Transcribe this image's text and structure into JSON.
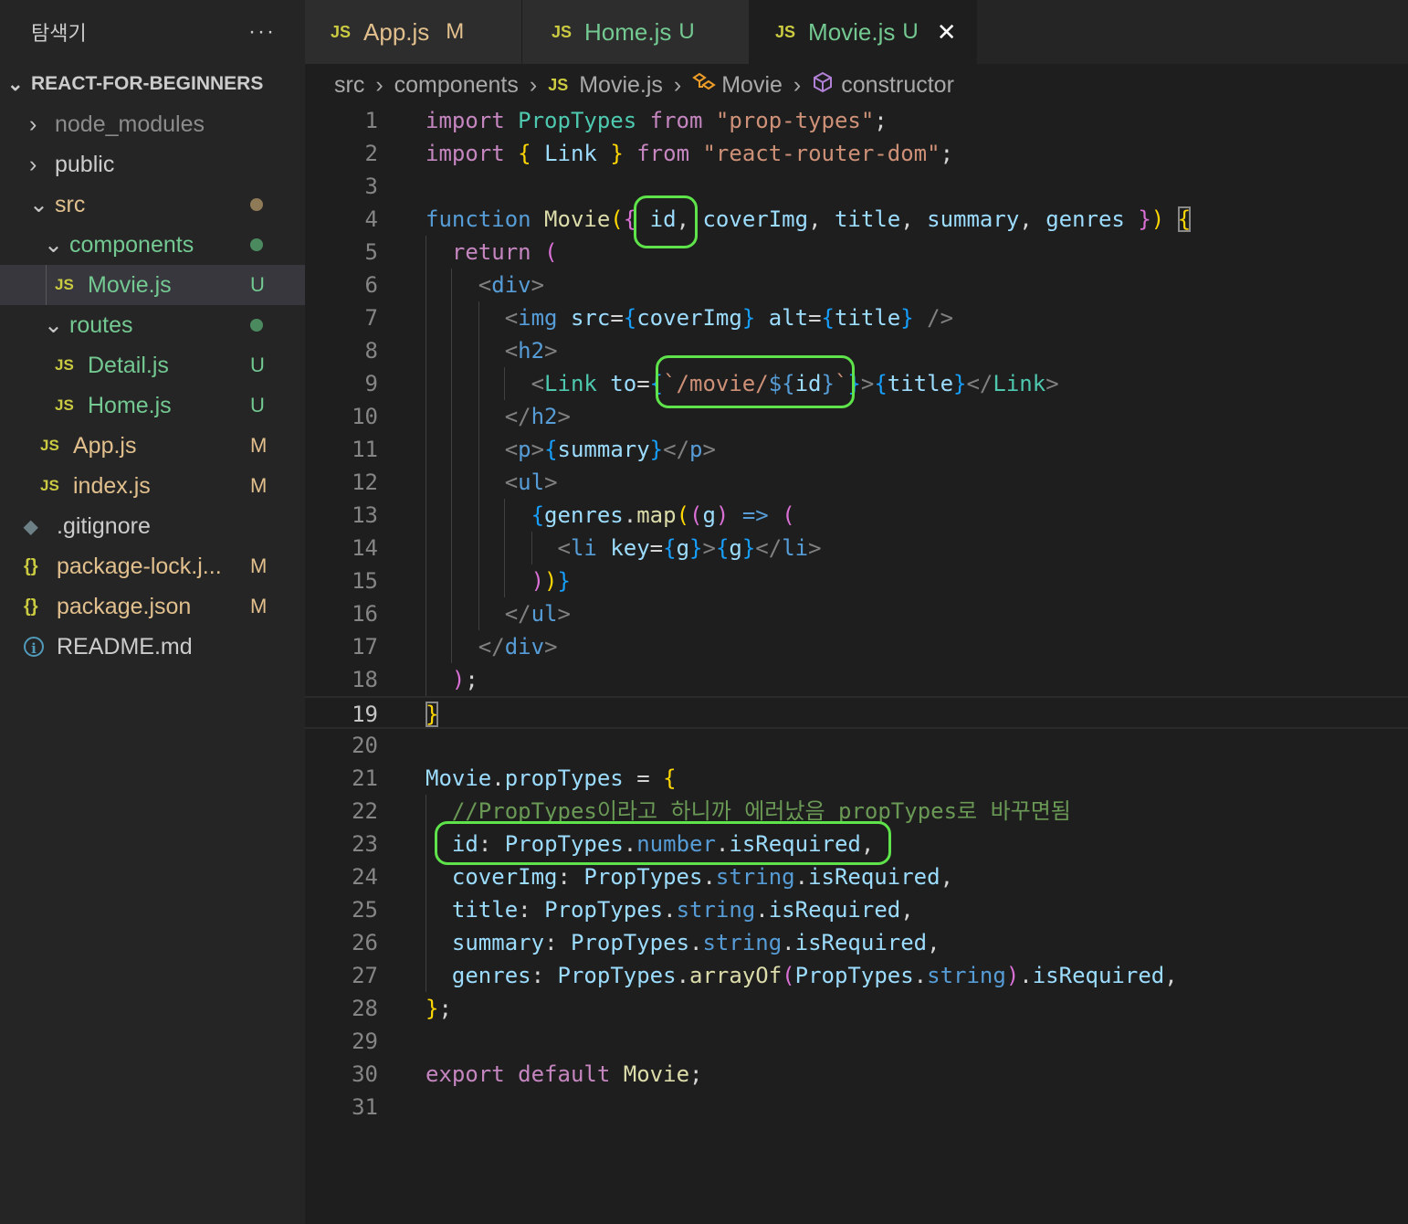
{
  "sidebar": {
    "title": "탐색기",
    "more": "···",
    "section": "REACT-FOR-BEGINNERS",
    "items": [
      {
        "label": "node_modules",
        "badge": ""
      },
      {
        "label": "public",
        "badge": ""
      },
      {
        "label": "src",
        "badge": ""
      },
      {
        "label": "components",
        "badge": ""
      },
      {
        "label": "Movie.js",
        "badge": "U"
      },
      {
        "label": "routes",
        "badge": ""
      },
      {
        "label": "Detail.js",
        "badge": "U"
      },
      {
        "label": "Home.js",
        "badge": "U"
      },
      {
        "label": "App.js",
        "badge": "M"
      },
      {
        "label": "index.js",
        "badge": "M"
      },
      {
        "label": ".gitignore",
        "badge": ""
      },
      {
        "label": "package-lock.j...",
        "badge": "M"
      },
      {
        "label": "package.json",
        "badge": "M"
      },
      {
        "label": "README.md",
        "badge": ""
      }
    ]
  },
  "icons": {
    "js": "JS",
    "json": "{}",
    "chevron_right": "›",
    "chevron_down": "⌄",
    "close": "✕",
    "info": "i",
    "git": "◆"
  },
  "tabs": [
    {
      "label": "App.js",
      "badge": "M"
    },
    {
      "label": "Home.js",
      "badge": "U"
    },
    {
      "label": "Movie.js",
      "badge": "U"
    }
  ],
  "breadcrumb": [
    "src",
    "components",
    "Movie.js",
    "Movie",
    "constructor"
  ],
  "editor": {
    "current_line": 19,
    "line_numbers": [
      "1",
      "2",
      "3",
      "4",
      "5",
      "6",
      "7",
      "8",
      "9",
      "10",
      "11",
      "12",
      "13",
      "14",
      "15",
      "16",
      "17",
      "18",
      "19",
      "20",
      "21",
      "22",
      "23",
      "24",
      "25",
      "26",
      "27",
      "28",
      "29",
      "30",
      "31"
    ],
    "code": [
      [
        [
          "kw",
          "import"
        ],
        [
          "pu",
          " "
        ],
        [
          "ty",
          "PropTypes"
        ],
        [
          "pu",
          " "
        ],
        [
          "kw",
          "from"
        ],
        [
          "pu",
          " "
        ],
        [
          "st",
          "\"prop-types\""
        ],
        [
          "pu",
          ";"
        ]
      ],
      [
        [
          "kw",
          "import"
        ],
        [
          "pu",
          " "
        ],
        [
          "b1",
          "{"
        ],
        [
          "pu",
          " "
        ],
        [
          "id",
          "Link"
        ],
        [
          "pu",
          " "
        ],
        [
          "b1",
          "}"
        ],
        [
          "pu",
          " "
        ],
        [
          "kw",
          "from"
        ],
        [
          "pu",
          " "
        ],
        [
          "st",
          "\"react-router-dom\""
        ],
        [
          "pu",
          ";"
        ]
      ],
      [],
      [
        [
          "kb",
          "function"
        ],
        [
          "pu",
          " "
        ],
        [
          "fn",
          "Movie"
        ],
        [
          "b1",
          "("
        ],
        [
          "b2",
          "{"
        ],
        [
          "pu",
          " "
        ],
        [
          "id",
          "id"
        ],
        [
          "pu",
          ", "
        ],
        [
          "id",
          "coverImg"
        ],
        [
          "pu",
          ", "
        ],
        [
          "id",
          "title"
        ],
        [
          "pu",
          ", "
        ],
        [
          "id",
          "summary"
        ],
        [
          "pu",
          ", "
        ],
        [
          "id",
          "genres"
        ],
        [
          "pu",
          " "
        ],
        [
          "b2",
          "}"
        ],
        [
          "b1",
          ")"
        ],
        [
          "pu",
          " "
        ],
        [
          "b1 cur",
          "{"
        ]
      ],
      [
        [
          "pu",
          "  "
        ],
        [
          "kw",
          "return"
        ],
        [
          "pu",
          " "
        ],
        [
          "b2",
          "("
        ]
      ],
      [
        [
          "pu",
          "    "
        ],
        [
          "tgb",
          "<"
        ],
        [
          "tg",
          "div"
        ],
        [
          "tgb",
          ">"
        ]
      ],
      [
        [
          "pu",
          "      "
        ],
        [
          "tgb",
          "<"
        ],
        [
          "tg",
          "img"
        ],
        [
          "pu",
          " "
        ],
        [
          "id",
          "src"
        ],
        [
          "pu",
          "="
        ],
        [
          "b3",
          "{"
        ],
        [
          "id",
          "coverImg"
        ],
        [
          "b3",
          "}"
        ],
        [
          "pu",
          " "
        ],
        [
          "id",
          "alt"
        ],
        [
          "pu",
          "="
        ],
        [
          "b3",
          "{"
        ],
        [
          "id",
          "title"
        ],
        [
          "b3",
          "}"
        ],
        [
          "pu",
          " "
        ],
        [
          "tgb",
          "/>"
        ]
      ],
      [
        [
          "pu",
          "      "
        ],
        [
          "tgb",
          "<"
        ],
        [
          "tg",
          "h2"
        ],
        [
          "tgb",
          ">"
        ]
      ],
      [
        [
          "pu",
          "        "
        ],
        [
          "tgb",
          "<"
        ],
        [
          "ty",
          "Link"
        ],
        [
          "pu",
          " "
        ],
        [
          "id",
          "to"
        ],
        [
          "pu",
          "="
        ],
        [
          "b3",
          "{"
        ],
        [
          "st",
          "`/movie/"
        ],
        [
          "kb",
          "${"
        ],
        [
          "id",
          "id"
        ],
        [
          "kb",
          "}"
        ],
        [
          "st",
          "`"
        ],
        [
          "b3",
          "}"
        ],
        [
          "tgb",
          ">"
        ],
        [
          "b3",
          "{"
        ],
        [
          "id",
          "title"
        ],
        [
          "b3",
          "}"
        ],
        [
          "tgb",
          "</"
        ],
        [
          "ty",
          "Link"
        ],
        [
          "tgb",
          ">"
        ]
      ],
      [
        [
          "pu",
          "      "
        ],
        [
          "tgb",
          "</"
        ],
        [
          "tg",
          "h2"
        ],
        [
          "tgb",
          ">"
        ]
      ],
      [
        [
          "pu",
          "      "
        ],
        [
          "tgb",
          "<"
        ],
        [
          "tg",
          "p"
        ],
        [
          "tgb",
          ">"
        ],
        [
          "b3",
          "{"
        ],
        [
          "id",
          "summary"
        ],
        [
          "b3",
          "}"
        ],
        [
          "tgb",
          "</"
        ],
        [
          "tg",
          "p"
        ],
        [
          "tgb",
          ">"
        ]
      ],
      [
        [
          "pu",
          "      "
        ],
        [
          "tgb",
          "<"
        ],
        [
          "tg",
          "ul"
        ],
        [
          "tgb",
          ">"
        ]
      ],
      [
        [
          "pu",
          "        "
        ],
        [
          "b3",
          "{"
        ],
        [
          "id",
          "genres"
        ],
        [
          "pu",
          "."
        ],
        [
          "fn",
          "map"
        ],
        [
          "b1",
          "("
        ],
        [
          "b2",
          "("
        ],
        [
          "id",
          "g"
        ],
        [
          "b2",
          ")"
        ],
        [
          "pu",
          " "
        ],
        [
          "kb",
          "=>"
        ],
        [
          "pu",
          " "
        ],
        [
          "b2",
          "("
        ]
      ],
      [
        [
          "pu",
          "          "
        ],
        [
          "tgb",
          "<"
        ],
        [
          "tg",
          "li"
        ],
        [
          "pu",
          " "
        ],
        [
          "id",
          "key"
        ],
        [
          "pu",
          "="
        ],
        [
          "b3",
          "{"
        ],
        [
          "id",
          "g"
        ],
        [
          "b3",
          "}"
        ],
        [
          "tgb",
          ">"
        ],
        [
          "b3",
          "{"
        ],
        [
          "id",
          "g"
        ],
        [
          "b3",
          "}"
        ],
        [
          "tgb",
          "</"
        ],
        [
          "tg",
          "li"
        ],
        [
          "tgb",
          ">"
        ]
      ],
      [
        [
          "pu",
          "        "
        ],
        [
          "b2",
          ")"
        ],
        [
          "b1",
          ")"
        ],
        [
          "b3",
          "}"
        ]
      ],
      [
        [
          "pu",
          "      "
        ],
        [
          "tgb",
          "</"
        ],
        [
          "tg",
          "ul"
        ],
        [
          "tgb",
          ">"
        ]
      ],
      [
        [
          "pu",
          "    "
        ],
        [
          "tgb",
          "</"
        ],
        [
          "tg",
          "div"
        ],
        [
          "tgb",
          ">"
        ]
      ],
      [
        [
          "pu",
          "  "
        ],
        [
          "b2",
          ")"
        ],
        [
          "pu",
          ";"
        ]
      ],
      [
        [
          "b1 cur",
          "}"
        ]
      ],
      [],
      [
        [
          "id",
          "Movie"
        ],
        [
          "pu",
          "."
        ],
        [
          "id",
          "propTypes"
        ],
        [
          "pu",
          " = "
        ],
        [
          "b1",
          "{"
        ]
      ],
      [
        [
          "pu",
          "  "
        ],
        [
          "cm",
          "//PropTypes이라고 하니까 에러났음 propTypes로 바꾸면됨"
        ]
      ],
      [
        [
          "pu",
          "  "
        ],
        [
          "id",
          "id"
        ],
        [
          "pu",
          ": "
        ],
        [
          "id",
          "PropTypes"
        ],
        [
          "pu",
          "."
        ],
        [
          "kb",
          "number"
        ],
        [
          "pu",
          "."
        ],
        [
          "id",
          "isRequired"
        ],
        [
          "pu",
          ","
        ]
      ],
      [
        [
          "pu",
          "  "
        ],
        [
          "id",
          "coverImg"
        ],
        [
          "pu",
          ": "
        ],
        [
          "id",
          "PropTypes"
        ],
        [
          "pu",
          "."
        ],
        [
          "kb",
          "string"
        ],
        [
          "pu",
          "."
        ],
        [
          "id",
          "isRequired"
        ],
        [
          "pu",
          ","
        ]
      ],
      [
        [
          "pu",
          "  "
        ],
        [
          "id",
          "title"
        ],
        [
          "pu",
          ": "
        ],
        [
          "id",
          "PropTypes"
        ],
        [
          "pu",
          "."
        ],
        [
          "kb",
          "string"
        ],
        [
          "pu",
          "."
        ],
        [
          "id",
          "isRequired"
        ],
        [
          "pu",
          ","
        ]
      ],
      [
        [
          "pu",
          "  "
        ],
        [
          "id",
          "summary"
        ],
        [
          "pu",
          ": "
        ],
        [
          "id",
          "PropTypes"
        ],
        [
          "pu",
          "."
        ],
        [
          "kb",
          "string"
        ],
        [
          "pu",
          "."
        ],
        [
          "id",
          "isRequired"
        ],
        [
          "pu",
          ","
        ]
      ],
      [
        [
          "pu",
          "  "
        ],
        [
          "id",
          "genres"
        ],
        [
          "pu",
          ": "
        ],
        [
          "id",
          "PropTypes"
        ],
        [
          "pu",
          "."
        ],
        [
          "fn",
          "arrayOf"
        ],
        [
          "b2",
          "("
        ],
        [
          "id",
          "PropTypes"
        ],
        [
          "pu",
          "."
        ],
        [
          "kb",
          "string"
        ],
        [
          "b2",
          ")"
        ],
        [
          "pu",
          "."
        ],
        [
          "id",
          "isRequired"
        ],
        [
          "pu",
          ","
        ]
      ],
      [
        [
          "b1",
          "}"
        ],
        [
          "pu",
          ";"
        ]
      ],
      [],
      [
        [
          "kw",
          "export"
        ],
        [
          "pu",
          " "
        ],
        [
          "kw",
          "default"
        ],
        [
          "pu",
          " "
        ],
        [
          "fn",
          "Movie"
        ],
        [
          "pu",
          ";"
        ]
      ],
      []
    ]
  },
  "colors": {
    "highlight_box": "#5ee34a",
    "modified": "#e2c08d",
    "untracked": "#73c991"
  }
}
